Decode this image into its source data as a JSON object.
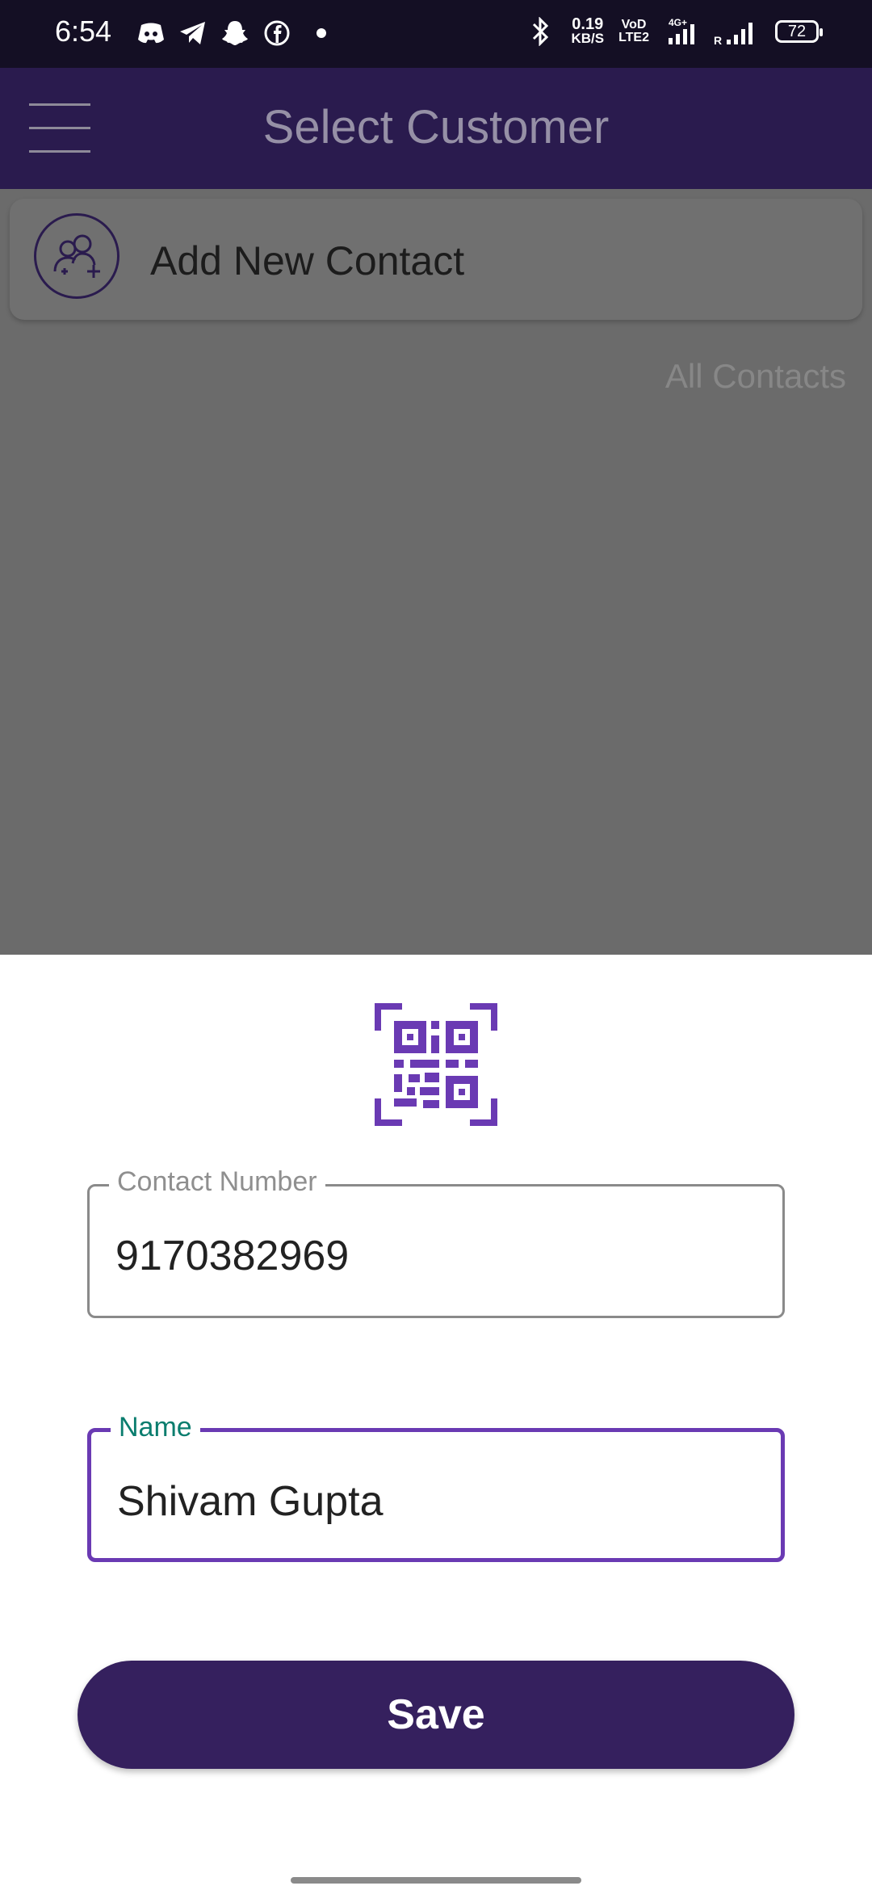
{
  "status_bar": {
    "time": "6:54",
    "left_icons": [
      "discord-icon",
      "telegram-icon",
      "snapchat-icon",
      "facebook-icon"
    ],
    "speed_value": "0.19",
    "speed_unit": "KB/S",
    "volte_top": "VoD",
    "volte_bottom": "LTE2",
    "network_type": "4G+",
    "roaming": "R",
    "battery": "72"
  },
  "app_bar": {
    "title": "Select Customer"
  },
  "add_contact": {
    "label": "Add New Contact"
  },
  "contacts_filter": {
    "label": "All Contacts"
  },
  "sheet": {
    "contact_field": {
      "label": "Contact Number",
      "value": "9170382969"
    },
    "name_field": {
      "label": "Name",
      "value": "Shivam Gupta"
    },
    "save_label": "Save"
  },
  "colors": {
    "primary": "#35205e",
    "focused_border": "#6a3ab3",
    "focused_label": "#0a7d6e",
    "qr_icon": "#6a3ab3"
  }
}
